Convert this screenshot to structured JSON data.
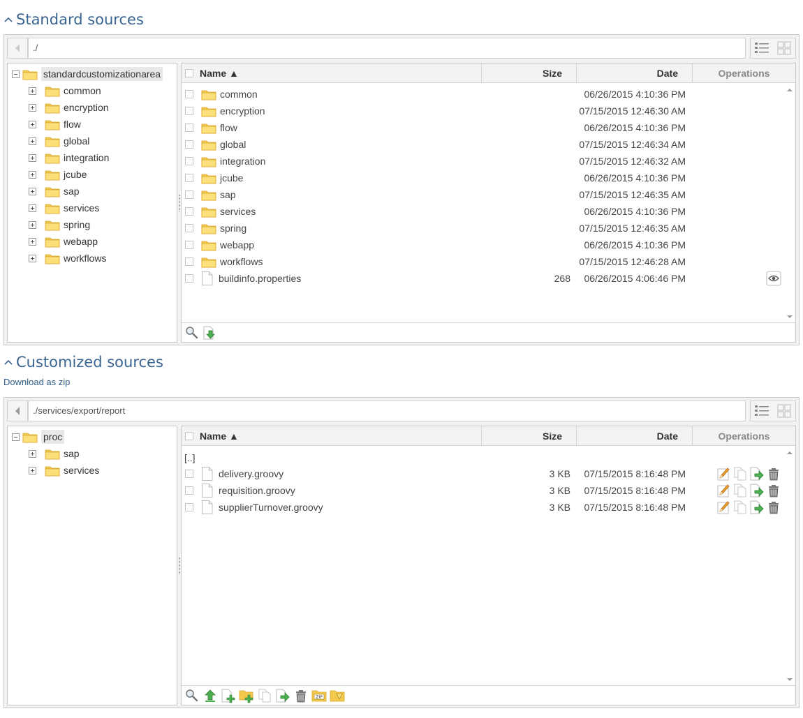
{
  "standard": {
    "title": "Standard sources",
    "path": "./",
    "tree": {
      "root": "standardcustomizationarea",
      "children": [
        "common",
        "encryption",
        "flow",
        "global",
        "integration",
        "jcube",
        "sap",
        "services",
        "spring",
        "webapp",
        "workflows"
      ]
    },
    "columns": {
      "name": "Name ▲",
      "size": "Size",
      "date": "Date",
      "ops": "Operations"
    },
    "rows": [
      {
        "name": "common",
        "size": "",
        "date": "06/26/2015 4:10:36 PM"
      },
      {
        "name": "encryption",
        "size": "",
        "date": "07/15/2015 12:46:30 AM"
      },
      {
        "name": "flow",
        "size": "",
        "date": "06/26/2015 4:10:36 PM"
      },
      {
        "name": "global",
        "size": "",
        "date": "07/15/2015 12:46:34 AM"
      },
      {
        "name": "integration",
        "size": "",
        "date": "07/15/2015 12:46:32 AM"
      },
      {
        "name": "jcube",
        "size": "",
        "date": "06/26/2015 4:10:36 PM"
      },
      {
        "name": "sap",
        "size": "",
        "date": "07/15/2015 12:46:35 AM"
      },
      {
        "name": "services",
        "size": "",
        "date": "06/26/2015 4:10:36 PM"
      },
      {
        "name": "spring",
        "size": "",
        "date": "07/15/2015 12:46:35 AM"
      },
      {
        "name": "webapp",
        "size": "",
        "date": "06/26/2015 4:10:36 PM"
      },
      {
        "name": "workflows",
        "size": "",
        "date": "07/15/2015 12:46:28 AM"
      },
      {
        "name": "buildinfo.properties",
        "size": "268",
        "date": "06/26/2015 4:06:46 PM"
      }
    ]
  },
  "customized": {
    "title": "Customized sources",
    "download_link": "Download as zip",
    "path": "./services/export/report",
    "tree": {
      "root": "proc",
      "children": [
        "sap",
        "services"
      ]
    },
    "columns": {
      "name": "Name ▲",
      "size": "Size",
      "date": "Date",
      "ops": "Operations"
    },
    "parent_label": "[..]",
    "rows": [
      {
        "name": "delivery.groovy",
        "size": "3 KB",
        "date": "07/15/2015 8:16:48 PM"
      },
      {
        "name": "requisition.groovy",
        "size": "3 KB",
        "date": "07/15/2015 8:16:48 PM"
      },
      {
        "name": "supplierTurnover.groovy",
        "size": "3 KB",
        "date": "07/15/2015 8:16:48 PM"
      }
    ]
  },
  "colors": {
    "accent": "#3a6592",
    "folder": "#f7d45c",
    "border": "#c8c8c8"
  }
}
